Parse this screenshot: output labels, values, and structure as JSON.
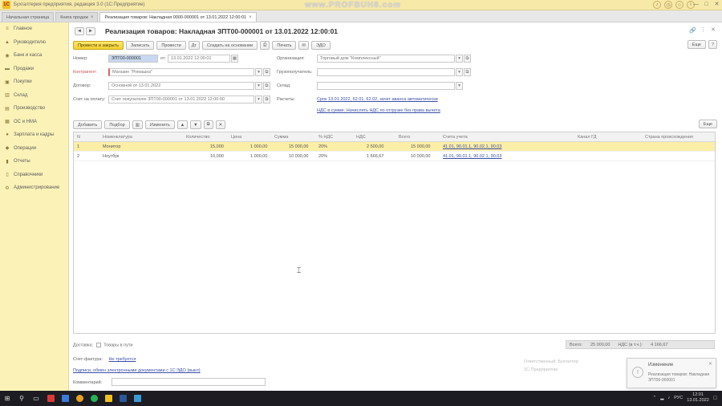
{
  "appbar": {
    "logo": "1С",
    "title": "Бухгалтерия предприятия, редакция 3.0 (1С:Предприятие)",
    "watermark": "www.PROFBUH8.com",
    "icons": [
      "bell-icon",
      "history-icon",
      "star-icon",
      "info-icon"
    ],
    "window_controls": [
      "—",
      "□",
      "✕"
    ]
  },
  "tabs": [
    {
      "label": "Начальная страница",
      "active": false
    },
    {
      "label": "Книга продаж",
      "active": false
    },
    {
      "label": "Реализация товаров: Накладная 0000-000001 от 13.01.2022 12:00:01",
      "active": true
    }
  ],
  "sidebar": {
    "items": [
      {
        "label": "Главное",
        "icon": "menu-icon"
      },
      {
        "label": "Руководителю",
        "icon": "chart-icon"
      },
      {
        "label": "Банк и касса",
        "icon": "bank-icon"
      },
      {
        "label": "Продажи",
        "icon": "sales-icon"
      },
      {
        "label": "Покупки",
        "icon": "purchases-icon"
      },
      {
        "label": "Склад",
        "icon": "warehouse-icon"
      },
      {
        "label": "Производство",
        "icon": "factory-icon"
      },
      {
        "label": "ОС и НМА",
        "icon": "assets-icon"
      },
      {
        "label": "Зарплата и кадры",
        "icon": "staff-icon"
      },
      {
        "label": "Операции",
        "icon": "operations-icon"
      },
      {
        "label": "Отчеты",
        "icon": "reports-icon"
      },
      {
        "label": "Справочники",
        "icon": "book-icon"
      },
      {
        "label": "Администрирование",
        "icon": "gear-icon"
      }
    ]
  },
  "document": {
    "title": "Реализация товаров: Накладная ЗПТ00-000001 от 13.01.2022 12:00:01",
    "nav_back": "◄",
    "nav_forward": "►",
    "link_icon": "🔗",
    "more_icon": "⋮",
    "close_icon": "✕",
    "toolbar": {
      "post_and_close": "Провести и закрыть",
      "save": "Записать",
      "post": "Провести",
      "dt_kt": "Дт",
      "create_based_on": "Создать на основании",
      "print": "Печать",
      "edo": "ЭДО",
      "more": "Еще",
      "help": "?"
    },
    "form": {
      "number_label": "Номер:",
      "number_value": "ЗПТ00-000001",
      "date_label": "от:",
      "date_value": "13.01.2022 12:00:01",
      "org_label": "Организация:",
      "org_value": "Торговый дом \"Комплексный\"",
      "counterparty_label": "Контрагент:",
      "counterparty_value": "Магазин \"Ромашка\"",
      "contract_label": "Договор:",
      "contract_value": "Основной от 13.01.2022",
      "payment_account_label": "Счет на оплату:",
      "payment_account_value": "Счет покупателю ЗПТ00-000001 от 13.01.2022 12:00:00",
      "consignee_label": "Грузополучатель:",
      "consignee_value": "",
      "warehouse_label": "Склад:",
      "settlements_label": "Расчеты:",
      "settlements_link": "Срок 13.01.2022, 62.01, 62.02, зачет аванса автоматически",
      "vat_link": "НДС в сумме. Начислять НДС по отгрузке без права вычета"
    },
    "table_toolbar": {
      "add": "Добавить",
      "pick": "Подбор",
      "change": "Изменить",
      "more": "Еще"
    },
    "table": {
      "columns": [
        "N",
        "Номенклатура",
        "Количество",
        "Цена",
        "Сумма",
        "% НДС",
        "НДС",
        "Всего",
        "Счета учета",
        "Канал ГД",
        "Страна происхождения"
      ],
      "rows": [
        {
          "n": "1",
          "name": "Монитор",
          "qty": "15,000",
          "price": "1 000,00",
          "sum": "15 000,00",
          "vat_rate": "20%",
          "vat": "2 500,00",
          "total": "15 000,00",
          "accounts": "41.01, 90.01.1, 90.02.1, 90.03",
          "selected": true
        },
        {
          "n": "2",
          "name": "Ноутбук",
          "qty": "10,000",
          "price": "1 000,00",
          "sum": "10 000,00",
          "vat_rate": "20%",
          "vat": "1 666,67",
          "total": "10 000,00",
          "accounts": "41.01, 90.01.1, 90.02.1, 90.03",
          "selected": false
        }
      ]
    },
    "bottom": {
      "invoice_label": "Счет-фактура:",
      "invoice_link": "Не требуется",
      "edo_link": "Подписи, обмен электронными документами с 1С:ЭДО (выкл)",
      "comment_label": "Комментарий:",
      "delivery_label": "Доставка:",
      "vat_checkbox_label": "Товары в пути",
      "totals_label": "Всего:",
      "totals_sum": "25 000,00",
      "totals_vat_label": "НДС (в т.ч.):",
      "totals_vat": "4 166,67",
      "responsible_text": "Ответственный: Бухгалтер",
      "system_text": "1С:Предприятие"
    }
  },
  "notification": {
    "title": "Изменение",
    "text": "Реализация товаров: Накладная ЗПТ00-000001",
    "close": "✕"
  },
  "taskbar": {
    "apps": [
      {
        "name": "start-icon",
        "color": "#e0e0e0"
      },
      {
        "name": "search-icon",
        "color": "#e0e0e0"
      },
      {
        "name": "taskview-icon",
        "color": "#e0e0e0"
      },
      {
        "name": "app-red-icon",
        "color": "#d83a3a"
      },
      {
        "name": "app-mail-icon",
        "color": "#3a7ad8"
      },
      {
        "name": "app-browser-icon",
        "color": "#e8a020"
      },
      {
        "name": "app-whatsapp-icon",
        "color": "#25b455"
      },
      {
        "name": "app-1c-icon",
        "color": "#f0c020"
      },
      {
        "name": "app-word-icon",
        "color": "#2b579a"
      },
      {
        "name": "app-blue-icon",
        "color": "#3a9ad8"
      }
    ],
    "lang": "РУС",
    "time": "12:01",
    "date": "13.01.2022"
  }
}
